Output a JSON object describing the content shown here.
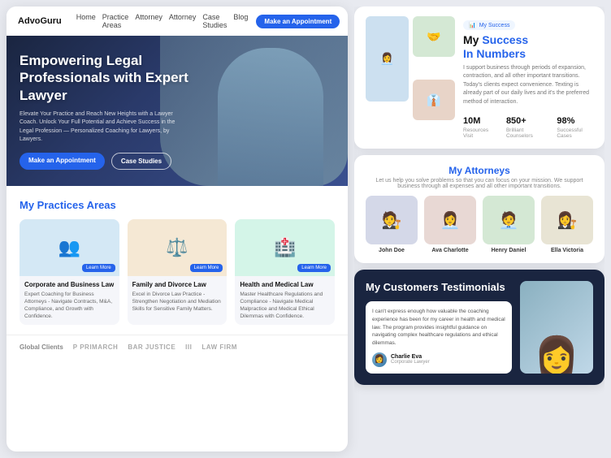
{
  "brand": "AdvoGuru",
  "nav": {
    "links": [
      "Home",
      "Practice Areas",
      "Attorney",
      "Attorney",
      "Case Studies",
      "Blog"
    ],
    "cta": "Make an Appointment"
  },
  "hero": {
    "title": "Empowering Legal Professionals with Expert Lawyer",
    "subtitle": "Elevate Your Practice and Reach New Heights with a Lawyer Coach. Unlock Your Full Potential and Achieve Success in the Legal Profession — Personalized Coaching for Lawyers, by Lawyers.",
    "btn_primary": "Make an Appointment",
    "btn_outline": "Case Studies"
  },
  "practices": {
    "heading_plain": "My ",
    "heading_colored": "Practices Areas",
    "cards": [
      {
        "emoji": "👥",
        "bg": "#d4e8f5",
        "title": "Corporate and Business Law",
        "desc": "Expert Coaching for Business Attorneys - Navigate Contracts, M&A, Compliance, and Growth with Confidence.",
        "learn_more": "Learn More"
      },
      {
        "emoji": "⚖️",
        "bg": "#f5e8d4",
        "title": "Family and Divorce Law",
        "desc": "Excel in Divorce Law Practice - Strengthen Negotiation and Mediation Skills for Sensitive Family Matters.",
        "learn_more": "Learn More"
      },
      {
        "emoji": "🏥",
        "bg": "#d4f5e8",
        "title": "Health and Medical Law",
        "desc": "Master Healthcare Regulations and Compliance - Navigate Medical Malpractice and Medical Ethical Dilemmas with Confidence.",
        "learn_more": "Learn More"
      }
    ]
  },
  "global_clients": {
    "label": "Global Clients",
    "logos": [
      "P PRIMARCH",
      "BAR JUSTICE",
      "III",
      "LAW FIRM"
    ]
  },
  "success": {
    "badge": "My Success",
    "heading_plain": "My ",
    "heading_line1": "Success",
    "heading_line2": "In Numbers",
    "desc": "I support business through periods of expansion, contraction, and all other important transitions. Today's clients expect convenience. Texting is already part of our daily lives and it's the preferred method of interaction.",
    "stats": [
      {
        "number": "10M",
        "label": "Resources Visit"
      },
      {
        "number": "850+",
        "label": "Brilliant Counselors"
      },
      {
        "number": "98%",
        "label": "Successful Cases"
      }
    ],
    "images": [
      {
        "emoji": "👩‍💼",
        "bg": "#cce0f0"
      },
      {
        "emoji": "🤝",
        "bg": "#d4e8d4"
      },
      {
        "emoji": "👔",
        "bg": "#e8d4c8"
      }
    ]
  },
  "attorneys": {
    "heading_plain": "My ",
    "heading_colored": "Attorneys",
    "subtitle": "Let us help you solve problems so that you can focus on your mission. We support business through all expenses and all other important transitions.",
    "team": [
      {
        "name": "John Doe",
        "emoji": "🧑‍⚖️",
        "bg": "#d4d8e8"
      },
      {
        "name": "Ava Charlotte",
        "emoji": "👩‍💼",
        "bg": "#e8d8d4"
      },
      {
        "name": "Henry Daniel",
        "emoji": "🧑‍💼",
        "bg": "#d4e8d4"
      },
      {
        "name": "Ella Victoria",
        "emoji": "👩‍⚖️",
        "bg": "#e8e4d4"
      }
    ]
  },
  "testimonials": {
    "title": "My Customers Testimonials",
    "text": "I can't express enough how valuable the coaching experience has been for my career in health and medical law. The program provides insightful guidance on navigating complex healthcare regulations and ethical dilemmas.",
    "author_name": "Charlie Eva",
    "author_role": "Corporate Lawyer"
  }
}
